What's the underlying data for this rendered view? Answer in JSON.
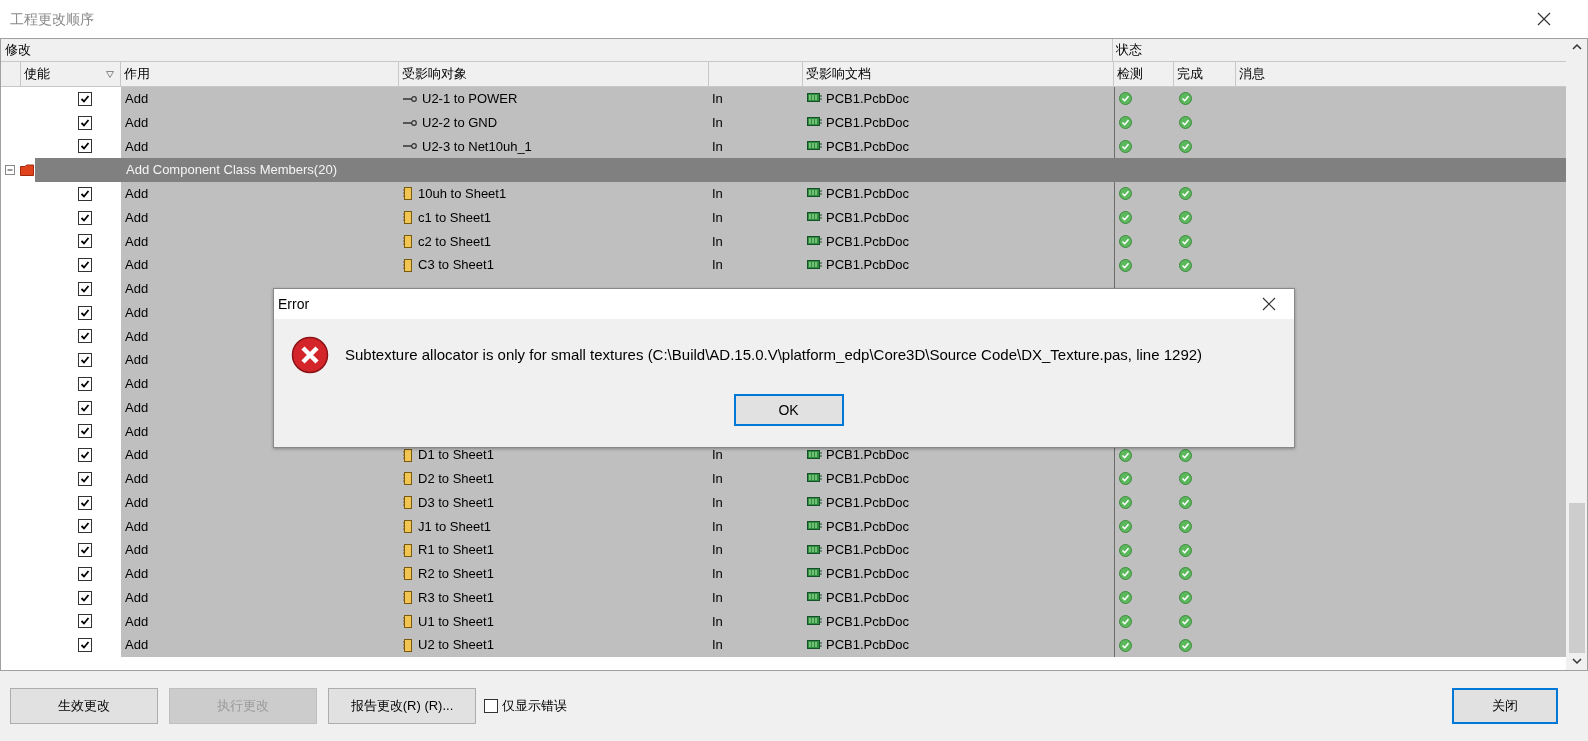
{
  "window": {
    "title": "工程更改顺序"
  },
  "table": {
    "column_groups": [
      {
        "label": "修改"
      },
      {
        "label": "状态"
      }
    ],
    "columns": [
      {
        "label": "使能",
        "filter": true
      },
      {
        "label": "作用"
      },
      {
        "label": "受影响对象"
      },
      {
        "label": "受影响文档"
      },
      {
        "label": "检测"
      },
      {
        "label": "完成"
      },
      {
        "label": "消息"
      }
    ],
    "rows": [
      {
        "kind": "change",
        "enabled": true,
        "action": "Add",
        "object": {
          "kind": "pin",
          "text": "U2-1 to POWER"
        },
        "direction": "In",
        "document": "PCB1.PcbDoc",
        "checked_ok": true,
        "done_ok": true
      },
      {
        "kind": "change",
        "enabled": true,
        "action": "Add",
        "object": {
          "kind": "pin",
          "text": "U2-2 to GND"
        },
        "direction": "In",
        "document": "PCB1.PcbDoc",
        "checked_ok": true,
        "done_ok": true
      },
      {
        "kind": "change",
        "enabled": true,
        "action": "Add",
        "object": {
          "kind": "pin",
          "text": "U2-3 to Net10uh_1"
        },
        "direction": "In",
        "document": "PCB1.PcbDoc",
        "checked_ok": true,
        "done_ok": true
      },
      {
        "kind": "group",
        "label": "Add Component Class Members(20)",
        "expanded": true
      },
      {
        "kind": "change",
        "enabled": true,
        "action": "Add",
        "object": {
          "kind": "component",
          "text": "10uh to Sheet1"
        },
        "direction": "In",
        "document": "PCB1.PcbDoc",
        "checked_ok": true,
        "done_ok": true
      },
      {
        "kind": "change",
        "enabled": true,
        "action": "Add",
        "object": {
          "kind": "component",
          "text": "c1 to Sheet1"
        },
        "direction": "In",
        "document": "PCB1.PcbDoc",
        "checked_ok": true,
        "done_ok": true
      },
      {
        "kind": "change",
        "enabled": true,
        "action": "Add",
        "object": {
          "kind": "component",
          "text": "c2 to Sheet1"
        },
        "direction": "In",
        "document": "PCB1.PcbDoc",
        "checked_ok": true,
        "done_ok": true
      },
      {
        "kind": "change",
        "enabled": true,
        "action": "Add",
        "object": {
          "kind": "component",
          "text": "C3 to Sheet1"
        },
        "direction": "In",
        "document": "PCB1.PcbDoc",
        "checked_ok": true,
        "done_ok": true
      },
      {
        "kind": "change",
        "enabled": true,
        "action": "Add"
      },
      {
        "kind": "change",
        "enabled": true,
        "action": "Add"
      },
      {
        "kind": "change",
        "enabled": true,
        "action": "Add"
      },
      {
        "kind": "change",
        "enabled": true,
        "action": "Add"
      },
      {
        "kind": "change",
        "enabled": true,
        "action": "Add"
      },
      {
        "kind": "change",
        "enabled": true,
        "action": "Add"
      },
      {
        "kind": "change",
        "enabled": true,
        "action": "Add"
      },
      {
        "kind": "change",
        "enabled": true,
        "action": "Add",
        "object": {
          "kind": "component",
          "text": "D1 to Sheet1"
        },
        "direction": "In",
        "document": "PCB1.PcbDoc",
        "checked_ok": true,
        "done_ok": true
      },
      {
        "kind": "change",
        "enabled": true,
        "action": "Add",
        "object": {
          "kind": "component",
          "text": "D2 to Sheet1"
        },
        "direction": "In",
        "document": "PCB1.PcbDoc",
        "checked_ok": true,
        "done_ok": true
      },
      {
        "kind": "change",
        "enabled": true,
        "action": "Add",
        "object": {
          "kind": "component",
          "text": "D3 to Sheet1"
        },
        "direction": "In",
        "document": "PCB1.PcbDoc",
        "checked_ok": true,
        "done_ok": true
      },
      {
        "kind": "change",
        "enabled": true,
        "action": "Add",
        "object": {
          "kind": "component",
          "text": "J1 to Sheet1"
        },
        "direction": "In",
        "document": "PCB1.PcbDoc",
        "checked_ok": true,
        "done_ok": true
      },
      {
        "kind": "change",
        "enabled": true,
        "action": "Add",
        "object": {
          "kind": "component",
          "text": "R1 to Sheet1"
        },
        "direction": "In",
        "document": "PCB1.PcbDoc",
        "checked_ok": true,
        "done_ok": true
      },
      {
        "kind": "change",
        "enabled": true,
        "action": "Add",
        "object": {
          "kind": "component",
          "text": "R2 to Sheet1"
        },
        "direction": "In",
        "document": "PCB1.PcbDoc",
        "checked_ok": true,
        "done_ok": true
      },
      {
        "kind": "change",
        "enabled": true,
        "action": "Add",
        "object": {
          "kind": "component",
          "text": "R3 to Sheet1"
        },
        "direction": "In",
        "document": "PCB1.PcbDoc",
        "checked_ok": true,
        "done_ok": true
      },
      {
        "kind": "change",
        "enabled": true,
        "action": "Add",
        "object": {
          "kind": "component",
          "text": "U1 to Sheet1"
        },
        "direction": "In",
        "document": "PCB1.PcbDoc",
        "checked_ok": true,
        "done_ok": true
      },
      {
        "kind": "change",
        "enabled": true,
        "action": "Add",
        "object": {
          "kind": "component",
          "text": "U2 to Sheet1"
        },
        "direction": "In",
        "document": "PCB1.PcbDoc",
        "checked_ok": true,
        "done_ok": true
      }
    ]
  },
  "buttons": [
    {
      "label": "生效更改",
      "disabled": false,
      "default": false
    },
    {
      "label": "执行更改",
      "disabled": true,
      "default": false
    },
    {
      "label": "报告更改(R) (R)...",
      "disabled": false,
      "default": false
    }
  ],
  "errors_only": {
    "label": "仅显示错误",
    "checked": false
  },
  "close_button": {
    "label": "关闭",
    "default": true
  },
  "error_dialog": {
    "title": "Error",
    "message": "Subtexture allocator is only for small textures (C:\\Build\\AD.15.0.V\\platform_edp\\Core3D\\Source Code\\DX_Texture.pas, line 1292)",
    "button": "OK"
  }
}
